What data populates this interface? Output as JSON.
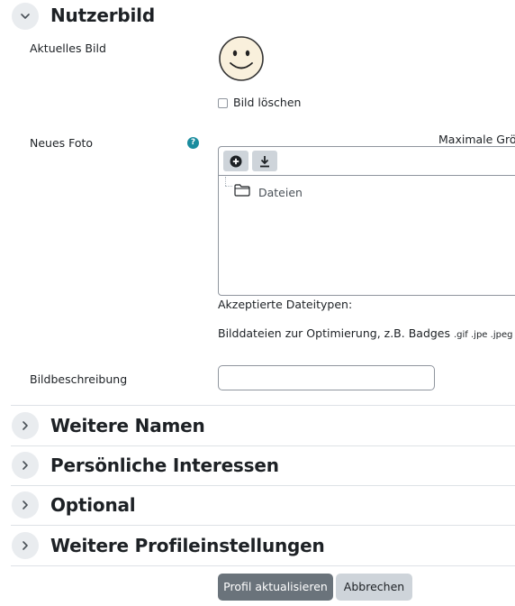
{
  "sections": {
    "nutzerbild": {
      "title": "Nutzerbild",
      "expanded": true
    },
    "weitere_namen": {
      "title": "Weitere Namen",
      "expanded": false
    },
    "persoenliche_interessen": {
      "title": "Persönliche Interessen",
      "expanded": false
    },
    "optional": {
      "title": "Optional",
      "expanded": false
    },
    "weitere_profileinstellungen": {
      "title": "Weitere Profileinstellungen",
      "expanded": false
    }
  },
  "current_picture": {
    "label": "Aktuelles Bild",
    "icon": "smiley-face-icon",
    "delete_checkbox": {
      "label": "Bild löschen",
      "checked": false
    }
  },
  "new_photo": {
    "label": "Neues Foto",
    "help_icon": "help-icon",
    "help_glyph": "?",
    "max_size_label": "Maximale Größe",
    "filepicker": {
      "toolbar": [
        "add-file-icon",
        "download-icon"
      ],
      "folder_label": "Dateien"
    },
    "accepted_label": "Akzeptierte Dateitypen:",
    "filetypes_desc": "Bilddateien zur Optimierung, z.B. Badges",
    "filetypes_ext": ".gif .jpe .jpeg .jpg"
  },
  "image_description": {
    "label": "Bildbeschreibung",
    "value": "",
    "placeholder": ""
  },
  "buttons": {
    "submit": "Profil aktualisieren",
    "cancel": "Abbrechen"
  },
  "colors": {
    "primary_button": "#6a737b",
    "secondary_button": "#ced4da",
    "help_icon": "#1a8c9e",
    "chevron_bg": "#e9ecef"
  }
}
